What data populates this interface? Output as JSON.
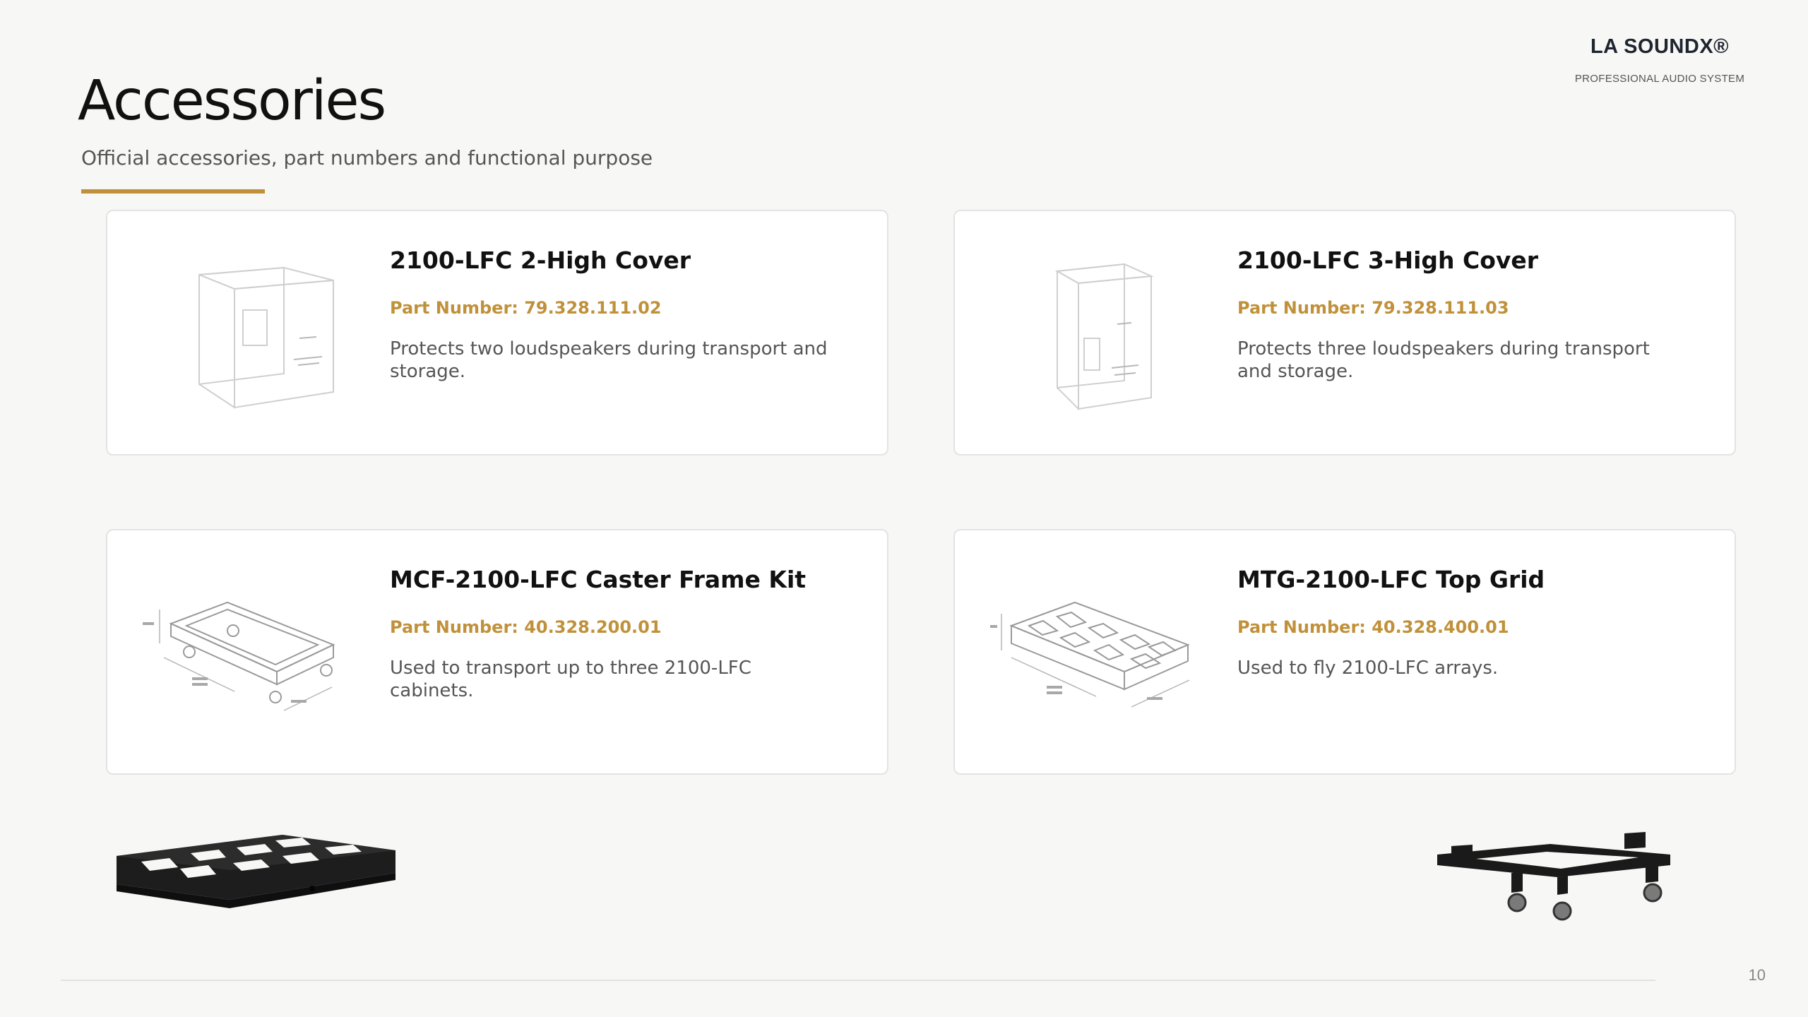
{
  "brand": {
    "name": "LA SOUNDX®",
    "tagline": "PROFESSIONAL AUDIO SYSTEM"
  },
  "header": {
    "title": "Accessories",
    "subtitle": "Official accessories, part numbers and functional purpose"
  },
  "accent_color": "#c0913a",
  "cards": [
    {
      "title": "2100-LFC 2-High Cover",
      "part_number": "Part Number: 79.328.111.02",
      "description": "Protects two loudspeakers during transport and storage.",
      "image": "cover-2-high-illustration"
    },
    {
      "title": "2100-LFC 3-High Cover",
      "part_number": "Part Number: 79.328.111.03",
      "description": "Protects three loudspeakers during transport and storage.",
      "image": "cover-3-high-illustration"
    },
    {
      "title": "MCF-2100-LFC Caster Frame Kit",
      "part_number": "Part Number: 40.328.200.01",
      "description": "Used to transport up to three 2100-LFC cabinets.",
      "image": "caster-frame-line-drawing"
    },
    {
      "title": "MTG-2100-LFC Top Grid",
      "part_number": "Part Number: 40.328.400.01",
      "description": "Used to fly 2100-LFC arrays.",
      "image": "top-grid-line-drawing"
    }
  ],
  "photos": {
    "left": "top-grid-photo",
    "right": "caster-frame-photo"
  },
  "footer": {
    "page_number": "10"
  }
}
